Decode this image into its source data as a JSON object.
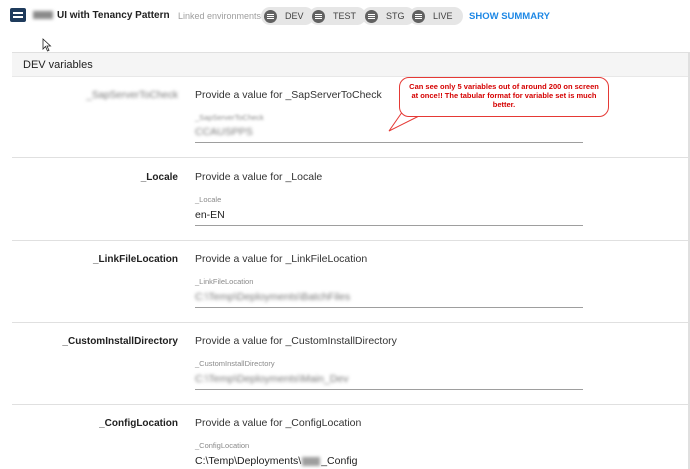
{
  "header": {
    "app_title": "UI with Tenancy Pattern",
    "linked_label": "Linked environments",
    "environments": [
      "DEV",
      "TEST",
      "STG",
      "LIVE"
    ],
    "show_summary": "SHOW SUMMARY"
  },
  "section": {
    "title": "DEV variables"
  },
  "variables": [
    {
      "name": "_SapServerToCheck",
      "prompt": "Provide a value for _SapServerToCheck",
      "field_label": "_SapServerToCheck",
      "value": "CCAUSPPS"
    },
    {
      "name": "_Locale",
      "prompt": "Provide a value for _Locale",
      "field_label": "_Locale",
      "value": "en-EN"
    },
    {
      "name": "_LinkFileLocation",
      "prompt": "Provide a value for _LinkFileLocation",
      "field_label": "_LinkFileLocation",
      "value": "C:\\Temp\\Deployments\\BatchFiles"
    },
    {
      "name": "_CustomInstallDirectory",
      "prompt": "Provide a value for _CustomInstallDirectory",
      "field_label": "_CustomInstallDirectory",
      "value": "C:\\Temp\\Deployments\\Main_Dev"
    },
    {
      "name": "_ConfigLocation",
      "prompt": "Provide a value for _ConfigLocation",
      "field_label": "_ConfigLocation",
      "value_prefix": "C:\\Temp\\Deployments\\",
      "value_suffix": "_Config"
    }
  ],
  "annotation": {
    "text": "Can see only 5 variables out of around 200 on screen at once!! The tabular format for variable set is much better."
  },
  "colors": {
    "accent_blue": "#1e88e5",
    "annotation_red": "#d50000",
    "chip_bg": "#e6e6e6"
  },
  "icons": [
    "app-icon",
    "list-icon",
    "mouse-cursor-icon"
  ]
}
